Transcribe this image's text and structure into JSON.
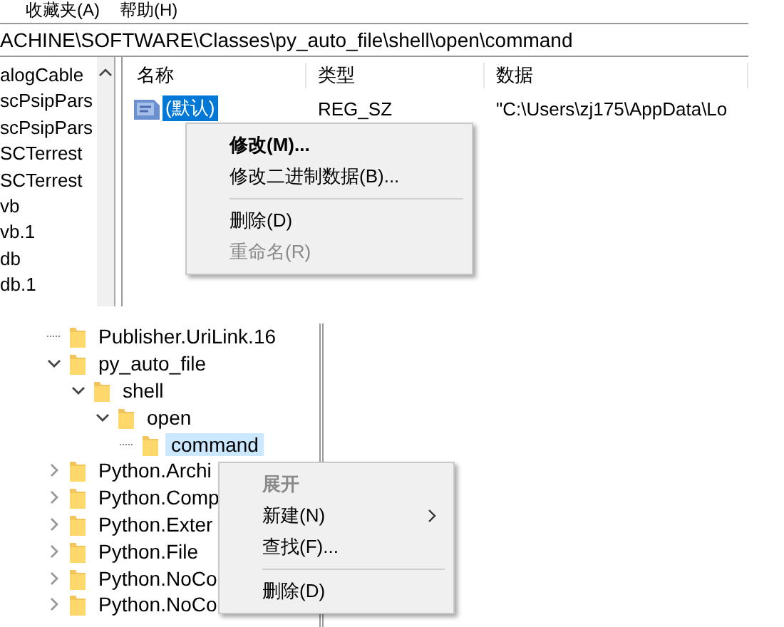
{
  "top": {
    "menubar": [
      "收藏夹(A)",
      "帮助(H)"
    ],
    "address": "ACHINE\\SOFTWARE\\Classes\\py_auto_file\\shell\\open\\command",
    "keys": [
      "alogCable",
      "scPsipPars",
      "scPsipPars",
      "SCTerrest",
      "SCTerrest",
      "vb",
      "vb.1",
      "db",
      "db.1"
    ],
    "columns": [
      "名称",
      "类型",
      "数据"
    ],
    "rows": [
      {
        "name": "(默认)",
        "type": "REG_SZ",
        "data": "\"C:\\Users\\zj175\\AppData\\Lo",
        "selected": true
      }
    ],
    "context_menu": [
      {
        "kind": "item",
        "label": "修改(M)...",
        "bold": true,
        "disabled": false
      },
      {
        "kind": "item",
        "label": "修改二进制数据(B)...",
        "bold": false,
        "disabled": false
      },
      {
        "kind": "separator"
      },
      {
        "kind": "item",
        "label": "删除(D)",
        "bold": false,
        "disabled": false
      },
      {
        "kind": "item",
        "label": "重命名(R)",
        "bold": false,
        "disabled": true
      }
    ]
  },
  "bottom": {
    "tree": [
      {
        "kind": "leaf",
        "label": "Publisher.UriLink.16",
        "selected": false
      },
      {
        "kind": "folder",
        "label": "py_auto_file",
        "expanded": true,
        "selected": false,
        "children": [
          {
            "kind": "folder",
            "label": "shell",
            "expanded": true,
            "selected": false,
            "children": [
              {
                "kind": "folder",
                "label": "open",
                "expanded": true,
                "selected": false,
                "children": [
                  {
                    "kind": "leaf",
                    "label": "command",
                    "selected": true
                  }
                ]
              }
            ]
          }
        ]
      },
      {
        "kind": "folder",
        "label": "Python.Archi",
        "expanded": false,
        "selected": false
      },
      {
        "kind": "folder",
        "label": "Python.Comp",
        "expanded": false,
        "selected": false
      },
      {
        "kind": "folder",
        "label": "Python.Exter",
        "expanded": false,
        "selected": false
      },
      {
        "kind": "folder",
        "label": "Python.File",
        "expanded": false,
        "selected": false
      },
      {
        "kind": "folder",
        "label": "Python.NoCo",
        "expanded": false,
        "selected": false
      },
      {
        "kind": "folder",
        "label": "Python.NoCo",
        "expanded": false,
        "selected": false
      }
    ],
    "context_menu": [
      {
        "kind": "item",
        "label": "展开",
        "bold": true,
        "disabled": true
      },
      {
        "kind": "submenu",
        "label": "新建(N)",
        "bold": false,
        "disabled": false
      },
      {
        "kind": "item",
        "label": "查找(F)...",
        "bold": false,
        "disabled": false
      },
      {
        "kind": "separator"
      },
      {
        "kind": "item",
        "label": "删除(D)",
        "bold": false,
        "disabled": false
      }
    ]
  }
}
